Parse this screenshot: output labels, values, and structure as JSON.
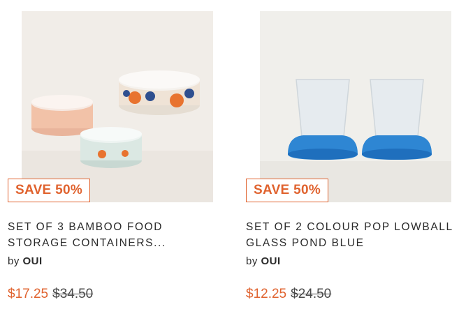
{
  "products": [
    {
      "badge": "SAVE 50%",
      "title_line1": "SET OF 3 BAMBOO FOOD",
      "title_line2": "STORAGE CONTAINERS...",
      "by_label": "by",
      "brand": "OUI",
      "sale_price": "$17.25",
      "original_price": "$34.50"
    },
    {
      "badge": "SAVE 50%",
      "title_line1": "SET OF 2 COLOUR POP LOWBALL",
      "title_line2": "GLASS POND BLUE",
      "by_label": "by",
      "brand": "OUI",
      "sale_price": "$12.25",
      "original_price": "$24.50"
    }
  ],
  "colors": {
    "accent": "#e0632f",
    "text": "#2b2b2b",
    "image_bg": "#f1ede8"
  }
}
